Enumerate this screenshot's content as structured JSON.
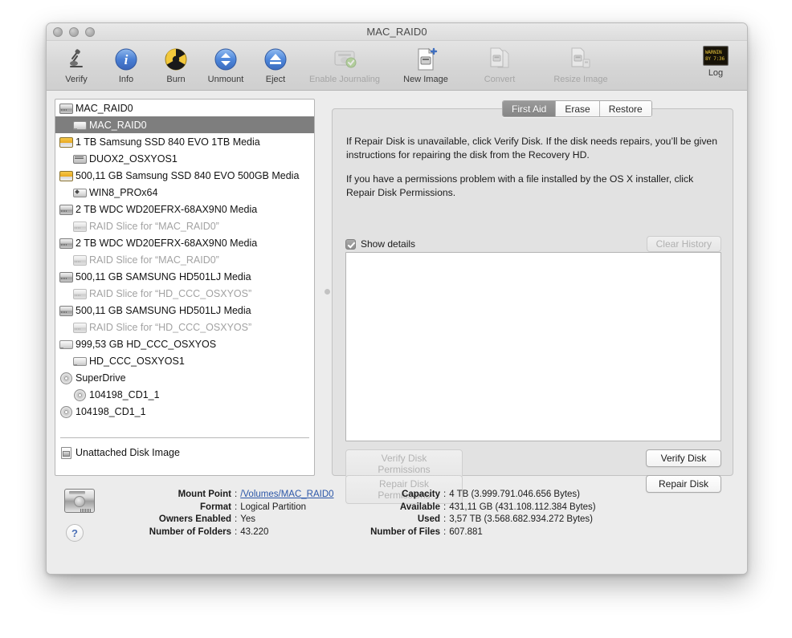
{
  "window": {
    "title": "MAC_RAID0",
    "traffic_lights": [
      "close-button",
      "minimize-button",
      "zoom-button"
    ]
  },
  "toolbar": {
    "items": [
      {
        "label": "Verify",
        "icon": "microscope-icon",
        "enabled": true,
        "width": "normal"
      },
      {
        "label": "Info",
        "icon": "info-icon",
        "enabled": true,
        "width": "normal"
      },
      {
        "label": "Burn",
        "icon": "burn-icon",
        "enabled": true,
        "width": "normal"
      },
      {
        "label": "Unmount",
        "icon": "unmount-icon",
        "enabled": true,
        "width": "normal"
      },
      {
        "label": "Eject",
        "icon": "eject-icon",
        "enabled": true,
        "width": "normal"
      },
      {
        "label": "Enable Journaling",
        "icon": "journaling-disk-icon",
        "enabled": false,
        "width": "wide"
      },
      {
        "label": "New Image",
        "icon": "new-image-icon",
        "enabled": true,
        "width": "wide2"
      },
      {
        "label": "Convert",
        "icon": "convert-icon",
        "enabled": false,
        "width": "wide2"
      },
      {
        "label": "Resize Image",
        "icon": "resize-image-icon",
        "enabled": false,
        "width": "wide"
      }
    ],
    "log": {
      "label": "Log",
      "icon": "log-console-icon",
      "screen_lines": [
        "WARNIN",
        "8Y 7:36"
      ]
    }
  },
  "sidebar": {
    "devices": [
      {
        "label": "MAC_RAID0",
        "icon": "hdd",
        "indent": false,
        "selected": false,
        "dim": false
      },
      {
        "label": "MAC_RAID0",
        "icon": "vol",
        "indent": true,
        "selected": true,
        "dim": false
      },
      {
        "label": "1 TB Samsung SSD 840 EVO 1TB Media",
        "icon": "ssd",
        "indent": false,
        "selected": false,
        "dim": false
      },
      {
        "label": "DUOX2_OSXYOS1",
        "icon": "part",
        "indent": true,
        "selected": false,
        "dim": false
      },
      {
        "label": "500,11 GB Samsung SSD 840 EVO 500GB Media",
        "icon": "ssd",
        "indent": false,
        "selected": false,
        "dim": false
      },
      {
        "label": "WIN8_PROx64",
        "icon": "win",
        "indent": true,
        "selected": false,
        "dim": false
      },
      {
        "label": "2 TB WDC WD20EFRX-68AX9N0 Media",
        "icon": "hdd",
        "indent": false,
        "selected": false,
        "dim": false
      },
      {
        "label": "RAID Slice for “MAC_RAID0”",
        "icon": "hdd",
        "indent": true,
        "selected": false,
        "dim": true
      },
      {
        "label": "2 TB WDC WD20EFRX-68AX9N0 Media",
        "icon": "hdd",
        "indent": false,
        "selected": false,
        "dim": false
      },
      {
        "label": "RAID Slice for “MAC_RAID0”",
        "icon": "hdd",
        "indent": true,
        "selected": false,
        "dim": true
      },
      {
        "label": "500,11 GB SAMSUNG HD501LJ Media",
        "icon": "hdd",
        "indent": false,
        "selected": false,
        "dim": false
      },
      {
        "label": "RAID Slice for “HD_CCC_OSXYOS”",
        "icon": "hdd",
        "indent": true,
        "selected": false,
        "dim": true
      },
      {
        "label": "500,11 GB SAMSUNG HD501LJ Media",
        "icon": "hdd",
        "indent": false,
        "selected": false,
        "dim": false
      },
      {
        "label": "RAID Slice for “HD_CCC_OSXYOS”",
        "icon": "hdd",
        "indent": true,
        "selected": false,
        "dim": true
      },
      {
        "label": "999,53 GB HD_CCC_OSXYOS",
        "icon": "vol",
        "indent": false,
        "selected": false,
        "dim": false
      },
      {
        "label": "HD_CCC_OSXYOS1",
        "icon": "vol",
        "indent": true,
        "selected": false,
        "dim": false
      },
      {
        "label": "SuperDrive",
        "icon": "disc",
        "indent": false,
        "selected": false,
        "dim": false
      },
      {
        "label": "104198_CD1_1",
        "icon": "disc",
        "indent": true,
        "selected": false,
        "dim": false
      },
      {
        "label": "104198_CD1_1",
        "icon": "disc",
        "indent": false,
        "selected": false,
        "dim": false
      }
    ],
    "unattached": {
      "label": "Unattached Disk Image",
      "icon": "dimg"
    }
  },
  "right_pane": {
    "tabs": [
      {
        "label": "First Aid",
        "active": true
      },
      {
        "label": "Erase",
        "active": false
      },
      {
        "label": "Restore",
        "active": false
      }
    ],
    "help_paragraphs": [
      "If Repair Disk is unavailable, click Verify Disk. If the disk needs repairs, you’ll be given instructions for repairing the disk from the Recovery HD.",
      "If you have a permissions problem with a file installed by the OS X installer, click Repair Disk Permissions."
    ],
    "show_details_label": "Show details",
    "show_details_checked": true,
    "clear_history_label": "Clear History",
    "clear_history_enabled": false,
    "log_output": "",
    "buttons": [
      {
        "id": "verify-disk-permissions",
        "label": "Verify Disk Permissions",
        "enabled": false
      },
      {
        "id": "repair-disk-permissions",
        "label": "Repair Disk Permissions",
        "enabled": false
      },
      {
        "id": "verify-disk",
        "label": "Verify Disk",
        "enabled": true
      },
      {
        "id": "repair-disk",
        "label": "Repair Disk",
        "enabled": true
      }
    ]
  },
  "info": {
    "help_button": "?",
    "left": [
      {
        "key": "Mount Point",
        "value": "/Volumes/MAC_RAID0",
        "link": true
      },
      {
        "key": "Format",
        "value": "Logical Partition",
        "link": false
      },
      {
        "key": "Owners Enabled",
        "value": "Yes",
        "link": false
      },
      {
        "key": "Number of Folders",
        "value": "43.220",
        "link": false
      }
    ],
    "right": [
      {
        "key": "Capacity",
        "value": "4 TB (3.999.791.046.656 Bytes)",
        "link": false
      },
      {
        "key": "Available",
        "value": "431,11 GB (431.108.112.384 Bytes)",
        "link": false
      },
      {
        "key": "Used",
        "value": "3,57 TB (3.568.682.934.272 Bytes)",
        "link": false
      },
      {
        "key": "Number of Files",
        "value": "607.881",
        "link": false
      }
    ]
  },
  "colors": {
    "selection": "#7e7e7e",
    "window_bg": "#ececec",
    "pane_bg": "#e2e2e2",
    "link": "#2b56a8",
    "ssd_icon": "#e8a81f",
    "log_text": "#e8c43a"
  }
}
